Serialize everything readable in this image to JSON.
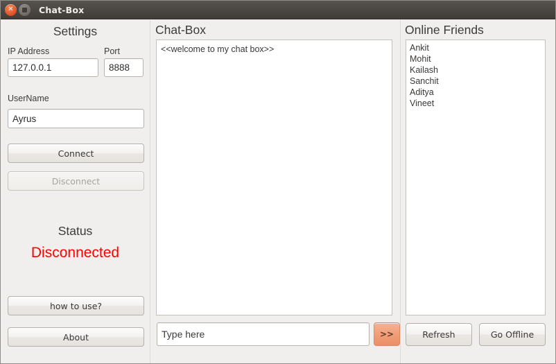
{
  "window": {
    "title": "Chat-Box",
    "close_icon": "close-icon",
    "maximize_icon": "maximize-icon"
  },
  "settings": {
    "title": "Settings",
    "ip_label": "IP Address",
    "ip_value": "127.0.0.1",
    "ip_placeholder": "",
    "port_label": "Port",
    "port_value": "8888",
    "port_placeholder": "",
    "username_label": "UserName",
    "username_value": "Ayrus",
    "username_placeholder": "",
    "connect_label": "Connect",
    "disconnect_label": "Disconnect",
    "status_title": "Status",
    "status_value": "Disconnected",
    "status_color": "#fe0000",
    "howto_label": "how to use?",
    "about_label": "About"
  },
  "chat": {
    "title": "Chat-Box",
    "log": "<<welcome to my chat box>>",
    "input_value": "",
    "input_placeholder": "Type here",
    "send_label": ">>",
    "send_color": "#f09f79"
  },
  "friends": {
    "title": "Online Friends",
    "items": [
      "Ankit",
      "Mohit",
      "Kailash",
      "Sanchit",
      "Aditya",
      "Vineet"
    ],
    "refresh_label": "Refresh",
    "go_offline_label": "Go Offline"
  }
}
